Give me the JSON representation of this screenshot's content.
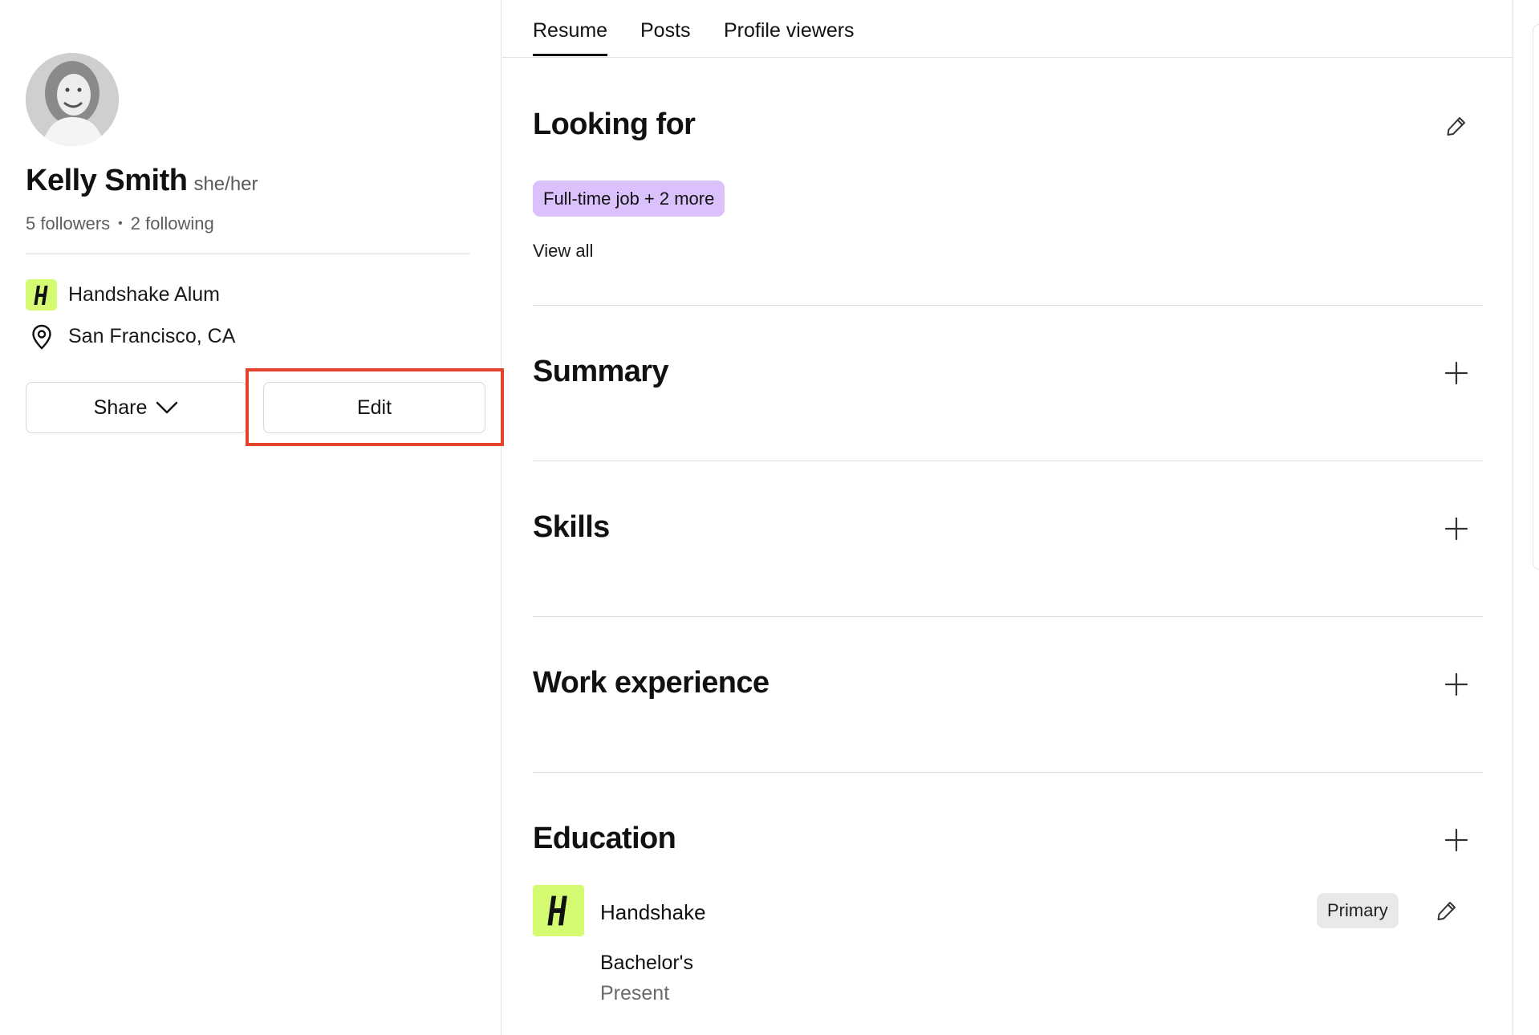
{
  "profile": {
    "name": "Kelly Smith",
    "pronouns": "she/her",
    "followers": "5 followers",
    "following": "2 following",
    "affiliation": "Handshake Alum",
    "location": "San Francisco, CA",
    "share_label": "Share",
    "edit_label": "Edit"
  },
  "tabs": [
    {
      "label": "Resume",
      "active": true
    },
    {
      "label": "Posts",
      "active": false
    },
    {
      "label": "Profile viewers",
      "active": false
    }
  ],
  "sections": {
    "looking_for": {
      "title": "Looking for",
      "pill": "Full-time job + 2 more",
      "view_all": "View all"
    },
    "summary": {
      "title": "Summary"
    },
    "skills": {
      "title": "Skills"
    },
    "work_experience": {
      "title": "Work experience"
    },
    "education": {
      "title": "Education",
      "school": "Handshake",
      "degree": "Bachelor's",
      "date": "Present",
      "badge": "Primary"
    }
  },
  "colors": {
    "brand_lime": "#d5fb72",
    "pill_purple": "#dbc1fb",
    "highlight_red": "#e2432a"
  },
  "icons": [
    "h-logo-icon",
    "location-pin-icon",
    "chevron-down-icon",
    "pencil-icon",
    "plus-icon"
  ]
}
